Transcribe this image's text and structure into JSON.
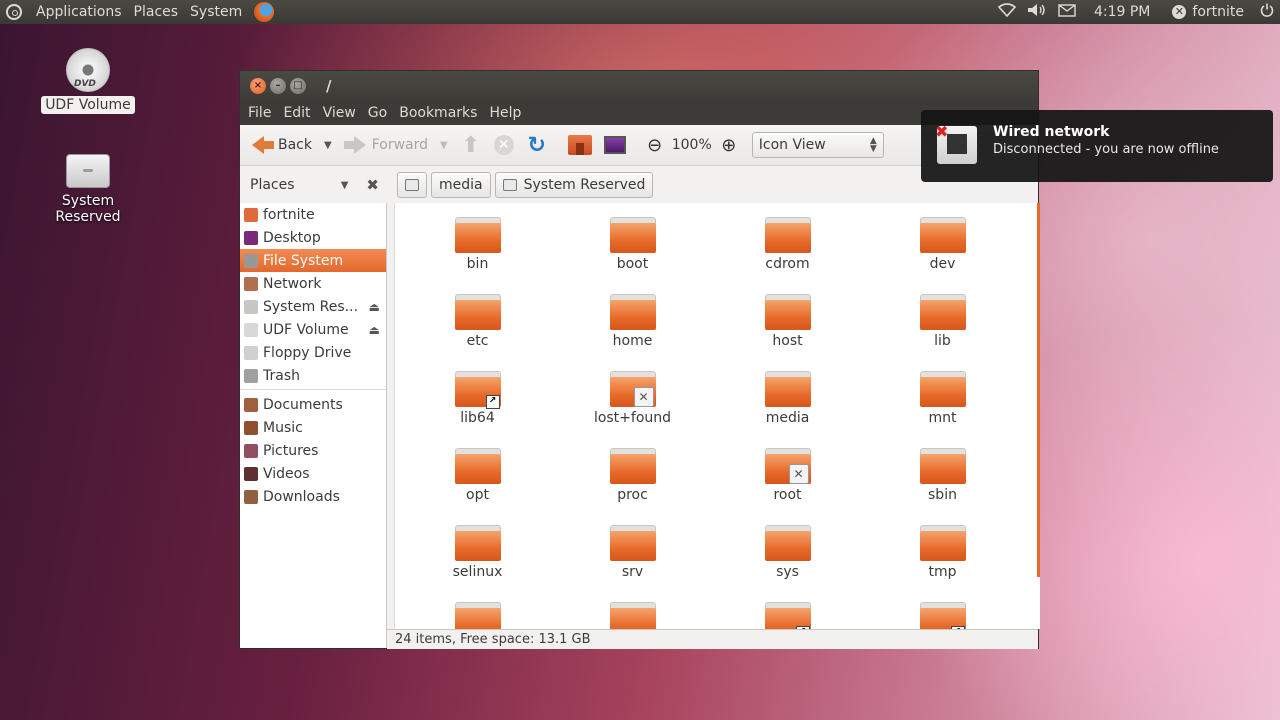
{
  "top_panel": {
    "menus": [
      "Applications",
      "Places",
      "System"
    ],
    "clock": "4:19 PM",
    "user": "fortnite",
    "icons": [
      "network-wifi-icon",
      "volume-icon",
      "mail-icon",
      "power-icon"
    ]
  },
  "desktop": {
    "icons": [
      {
        "label": "UDF Volume",
        "icon": "dvd-icon",
        "selected": true
      },
      {
        "label": "System Reserved",
        "icon": "hard-drive-icon",
        "selected": false
      }
    ]
  },
  "window": {
    "title": "/",
    "menu": [
      "File",
      "Edit",
      "View",
      "Go",
      "Bookmarks",
      "Help"
    ],
    "toolbar": {
      "back": "Back",
      "forward": "Forward",
      "zoom": "100%",
      "view_mode": "Icon View"
    },
    "sidebar": {
      "header": "Places",
      "items": [
        {
          "label": "fortnite",
          "icon": "home-folder-icon",
          "color": "#e06a3a"
        },
        {
          "label": "Desktop",
          "icon": "desktop-icon",
          "color": "#7a2a7a"
        },
        {
          "label": "File System",
          "icon": "filesystem-icon",
          "color": "#9a9894",
          "active": true
        },
        {
          "label": "Network",
          "icon": "network-icon",
          "color": "#b07050"
        },
        {
          "label": "System Res...",
          "icon": "drive-icon",
          "color": "#c8c6c2",
          "eject": true
        },
        {
          "label": "UDF Volume",
          "icon": "disc-icon",
          "color": "#d8d8d8",
          "eject": true
        },
        {
          "label": "Floppy Drive",
          "icon": "floppy-icon",
          "color": "#d0d0d0"
        },
        {
          "label": "Trash",
          "icon": "trash-icon",
          "color": "#a0a0a0"
        }
      ],
      "bookmarks": [
        {
          "label": "Documents",
          "icon": "documents-icon",
          "color": "#a06040"
        },
        {
          "label": "Music",
          "icon": "music-icon",
          "color": "#905030"
        },
        {
          "label": "Pictures",
          "icon": "pictures-icon",
          "color": "#905060"
        },
        {
          "label": "Videos",
          "icon": "videos-icon",
          "color": "#603030"
        },
        {
          "label": "Downloads",
          "icon": "downloads-icon",
          "color": "#906040"
        }
      ]
    },
    "breadcrumbs": [
      "media",
      "System Reserved"
    ],
    "files": [
      {
        "name": "bin"
      },
      {
        "name": "boot"
      },
      {
        "name": "cdrom"
      },
      {
        "name": "dev"
      },
      {
        "name": "etc"
      },
      {
        "name": "home"
      },
      {
        "name": "host"
      },
      {
        "name": "lib"
      },
      {
        "name": "lib64",
        "emblem": "link"
      },
      {
        "name": "lost+found",
        "emblem": "locked"
      },
      {
        "name": "media"
      },
      {
        "name": "mnt"
      },
      {
        "name": "opt"
      },
      {
        "name": "proc"
      },
      {
        "name": "root",
        "emblem": "locked"
      },
      {
        "name": "sbin"
      },
      {
        "name": "selinux"
      },
      {
        "name": "srv"
      },
      {
        "name": "sys"
      },
      {
        "name": "tmp"
      },
      {
        "name": ""
      },
      {
        "name": ""
      },
      {
        "name": "",
        "emblem": "link"
      },
      {
        "name": "",
        "emblem": "link"
      }
    ],
    "status": "24 items, Free space: 13.1 GB"
  },
  "notification": {
    "title": "Wired network",
    "body": "Disconnected - you are now offline"
  }
}
